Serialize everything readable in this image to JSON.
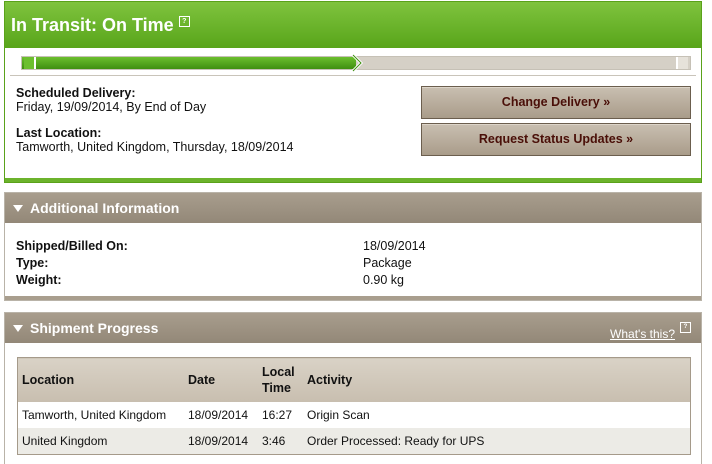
{
  "status": {
    "title": "In Transit: On Time",
    "help_glyph": "?",
    "progress_fraction": 0.5,
    "scheduled_label": "Scheduled Delivery:",
    "scheduled_value": "Friday, 19/09/2014, By End of Day",
    "last_location_label": "Last Location:",
    "last_location_value": "Tamworth, United Kingdom, Thursday, 18/09/2014",
    "change_delivery": "Change Delivery »",
    "request_updates": "Request Status Updates »"
  },
  "additional": {
    "header": "Additional Information",
    "rows": [
      {
        "label": "Shipped/Billed On:",
        "value": "18/09/2014"
      },
      {
        "label": "Type:",
        "value": "Package"
      },
      {
        "label": "Weight:",
        "value": "0.90 kg"
      }
    ]
  },
  "shipment": {
    "header": "Shipment Progress",
    "whats_this": "What's this?",
    "columns": [
      "Location",
      "Date",
      "Local Time",
      "Activity"
    ],
    "rows": [
      {
        "location": "Tamworth, United Kingdom",
        "date": "18/09/2014",
        "time": "16:27",
        "activity": "Origin Scan"
      },
      {
        "location": "United Kingdom",
        "date": "18/09/2014",
        "time": "3:46",
        "activity": "Order Processed: Ready for UPS"
      }
    ]
  },
  "colors": {
    "status_green": "#58a51a",
    "section_header": "#938878",
    "button_text": "#4a0f08"
  }
}
